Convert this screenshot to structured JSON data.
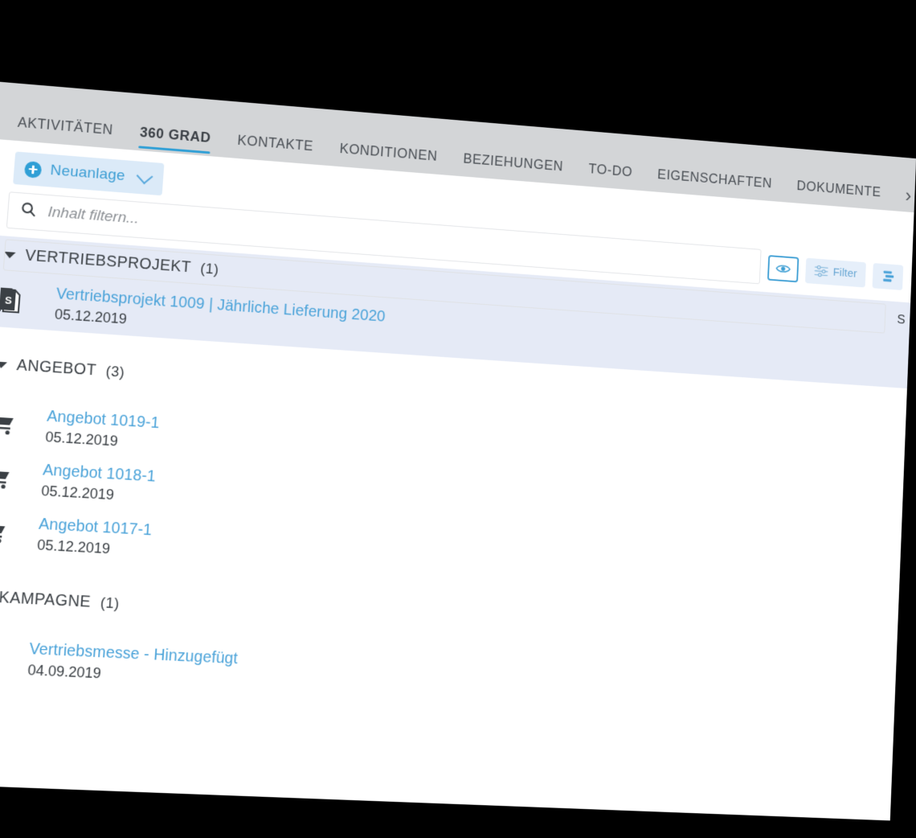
{
  "tabs": [
    {
      "label": "AKTIVITÄTEN",
      "active": false
    },
    {
      "label": "360 GRAD",
      "active": true
    },
    {
      "label": "KONTAKTE",
      "active": false
    },
    {
      "label": "KONDITIONEN",
      "active": false
    },
    {
      "label": "BEZIEHUNGEN",
      "active": false
    },
    {
      "label": "TO-DO",
      "active": false
    },
    {
      "label": "EIGENSCHAFTEN",
      "active": false
    },
    {
      "label": "DOKUMENTE",
      "active": false
    }
  ],
  "tab_overflow_icon": "chevron-right-icon",
  "toolbar": {
    "new_button_label": "Neuanlage",
    "new_button_icon": "plus-circle-icon",
    "new_button_dropdown_icon": "chevron-down-icon",
    "filter_button_label": "Filter",
    "filter_button_icon": "sliders-icon",
    "preview_button_icon": "eye-icon",
    "layers_button_icon": "layers-icon"
  },
  "search": {
    "placeholder": "Inhalt filtern...",
    "value": "",
    "icon": "search-icon"
  },
  "group_header_edge_char": "S",
  "groups": [
    {
      "title": "VERTRIEBSPROJEKT",
      "count": "(1)",
      "highlight": true,
      "items": [
        {
          "title": "Vertriebsprojekt 1009 | Jährliche Lieferung 2020",
          "date": "05.12.2019",
          "icon": "document-s-icon",
          "selected": true
        }
      ]
    },
    {
      "title": "ANGEBOT",
      "count": "(3)",
      "highlight": false,
      "items": [
        {
          "title": "Angebot 1019-1",
          "date": "05.12.2019",
          "icon": "cart-icon",
          "selected": false
        },
        {
          "title": "Angebot 1018-1",
          "date": "05.12.2019",
          "icon": "cart-icon",
          "selected": false
        },
        {
          "title": "Angebot 1017-1",
          "date": "05.12.2019",
          "icon": "cart-icon",
          "selected": false
        }
      ]
    },
    {
      "title": "KAMPAGNE",
      "count": "(1)",
      "highlight": false,
      "items": [
        {
          "title": "Vertriebsmesse - Hinzugefügt",
          "date": "04.09.2019",
          "icon": "people-icon",
          "selected": false
        }
      ]
    }
  ],
  "colors": {
    "accent_blue": "#2f9fd6",
    "link_blue": "#4ba3d9",
    "tabbar_gray": "#d3d5d7",
    "row_highlight": "#e5eaf6",
    "button_bg": "#dbeaf8",
    "text_dark": "#3b4045"
  }
}
